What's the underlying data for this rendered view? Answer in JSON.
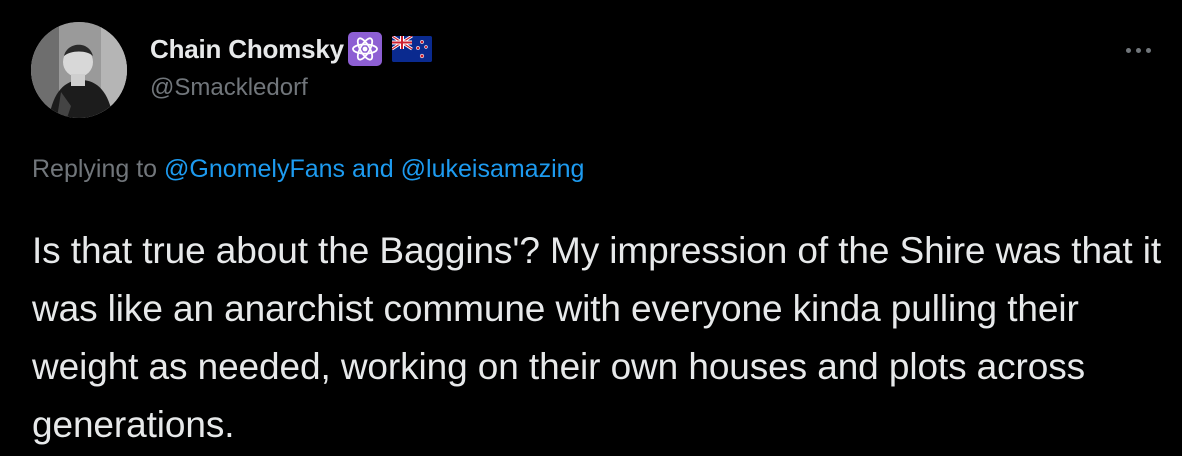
{
  "tweet": {
    "author": {
      "display_name": "Chain Chomsky",
      "handle": "@Smackledorf",
      "badges": [
        "atom-emoji-icon",
        "new-zealand-flag-icon"
      ]
    },
    "reply": {
      "prefix": "Replying to",
      "mention_1": "@GnomelyFans",
      "conjunction": "and",
      "mention_2": "@lukeisamazing"
    },
    "text": "Is that true about the Baggins'? My impression of the Shire was that it was like an anarchist commune with everyone kinda pulling their weight as needed, working on their own houses and plots across generations."
  },
  "icons": {
    "more": "more-options-icon"
  },
  "colors": {
    "background": "#000000",
    "text_primary": "#e7e9ea",
    "text_secondary": "#71767b",
    "link": "#1d9bf0",
    "badge_purple": "#8d5fd3"
  }
}
